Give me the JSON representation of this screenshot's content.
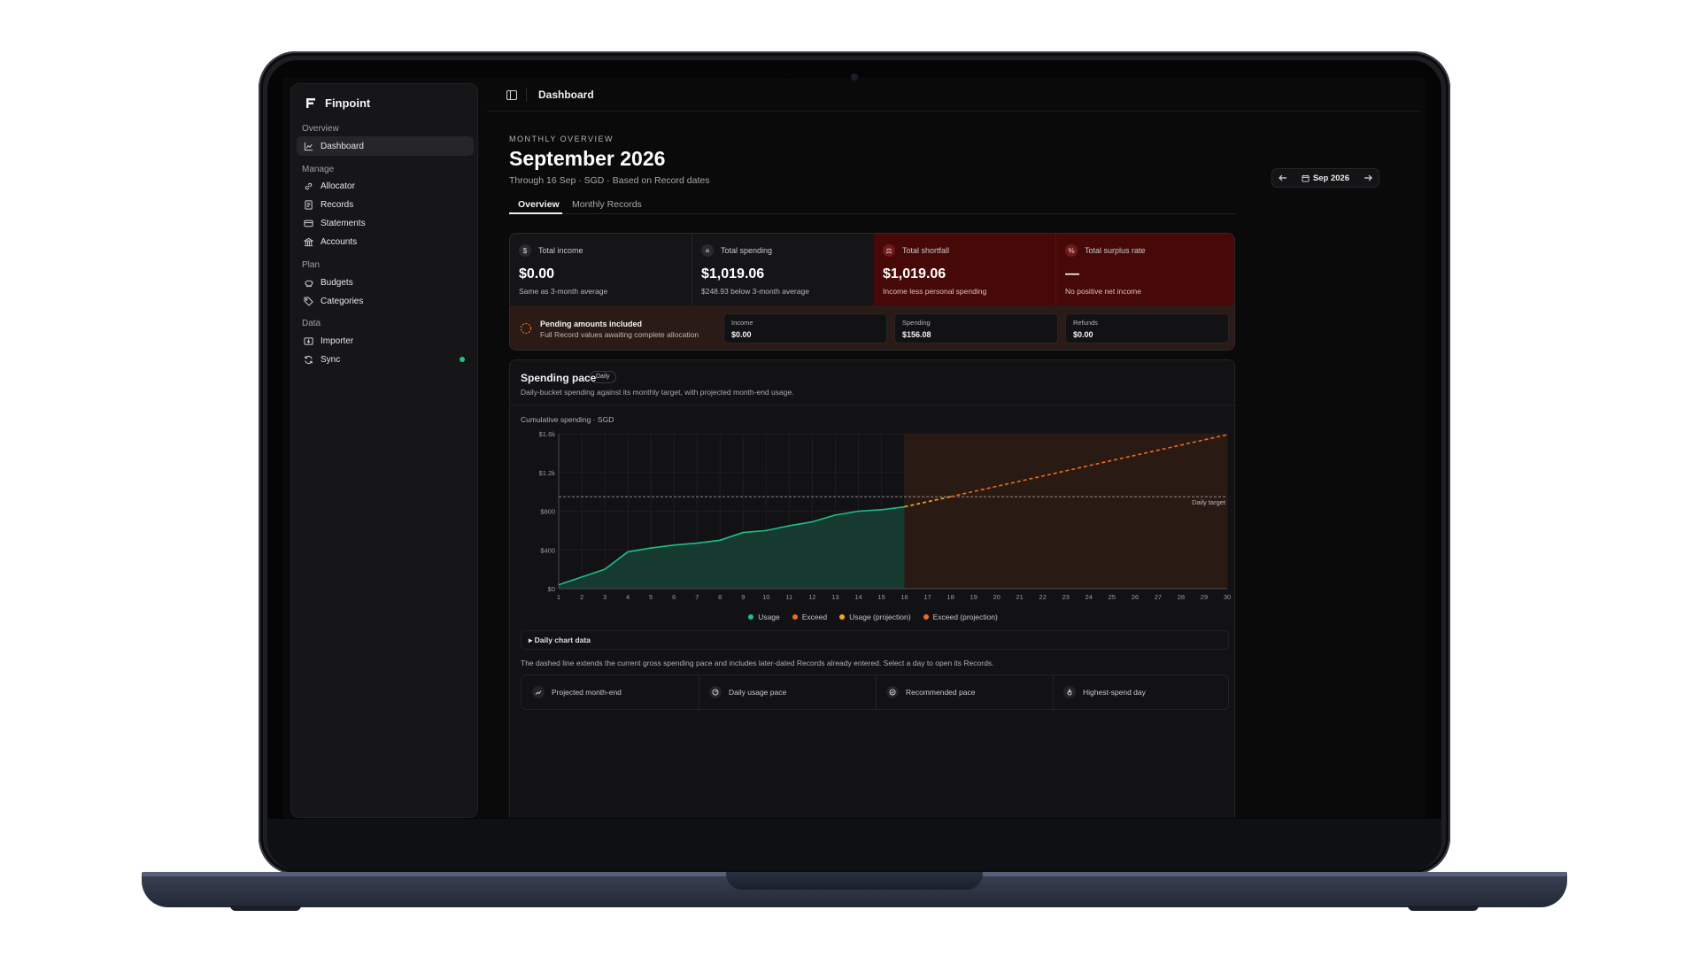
{
  "brand": {
    "name": "Finpoint"
  },
  "sidebar": {
    "sections": {
      "overview": "Overview",
      "manage": "Manage",
      "plan": "Plan",
      "data": "Data"
    },
    "items": {
      "dashboard": "Dashboard",
      "allocator": "Allocator",
      "records": "Records",
      "statements": "Statements",
      "accounts": "Accounts",
      "budgets": "Budgets",
      "categories": "Categories",
      "importer": "Importer",
      "sync": "Sync"
    }
  },
  "topbar": {
    "title": "Dashboard"
  },
  "header": {
    "eyebrow": "MONTHLY OVERVIEW",
    "title": "September 2026",
    "subtitle": "Through 16 Sep · SGD · Based on Record dates",
    "month_label": "Sep 2026"
  },
  "tabs": {
    "overview": "Overview",
    "monthly_records": "Monthly Records"
  },
  "kpis": {
    "income": {
      "label": "Total income",
      "value": "$0.00",
      "note": "Same as 3-month average"
    },
    "spending": {
      "label": "Total spending",
      "value": "$1,019.06",
      "note": "$248.93 below 3-month average"
    },
    "shortfall": {
      "label": "Total shortfall",
      "value": "$1,019.06",
      "note": "Income less personal spending"
    },
    "surplus": {
      "label": "Total surplus rate",
      "value": "—",
      "note": "No positive net income"
    }
  },
  "pending": {
    "title": "Pending amounts included",
    "subtitle": "Full Record values awaiting complete allocation",
    "income_label": "Income",
    "income_value": "$0.00",
    "spending_label": "Spending",
    "spending_value": "$156.08",
    "refunds_label": "Refunds",
    "refunds_value": "$0.00"
  },
  "pace": {
    "title": "Spending pace",
    "badge": "Daily",
    "subtitle": "Daily-bucket spending against its monthly target, with projected month-end usage.",
    "chart_label": "Cumulative spending · SGD",
    "details_label": "▸ Daily chart data",
    "footnote": "The dashed line extends the current gross spending pace and includes later-dated Records already entered. Select a day to open its Records.",
    "stats": {
      "projected": "Projected month-end",
      "daily_pace": "Daily usage pace",
      "recommended": "Recommended pace",
      "highest": "Highest-spend day"
    }
  },
  "colors": {
    "usage": "#1dbf84",
    "exceed": "#f26a21",
    "usage_projection": "#f5a623",
    "exceed_projection": "#f26a21"
  },
  "chart_data": {
    "type": "line",
    "ylabel": "Cumulative spending · SGD",
    "x": [
      1,
      2,
      3,
      4,
      5,
      6,
      7,
      8,
      9,
      10,
      11,
      12,
      13,
      14,
      15,
      16,
      17,
      18,
      19,
      20,
      21,
      22,
      23,
      24,
      25,
      26,
      27,
      28,
      29,
      30
    ],
    "xlim": [
      1,
      30
    ],
    "ylim": [
      0,
      1600
    ],
    "y_ticks": [
      0,
      400,
      800,
      1200,
      1600
    ],
    "y_tick_labels": [
      "$0",
      "$400",
      "$800",
      "$1.2k",
      "$1.6k"
    ],
    "target": {
      "label": "Daily target",
      "value": 950
    },
    "series": [
      {
        "name": "Usage",
        "x": [
          1,
          2,
          3,
          4,
          5,
          6,
          7,
          8,
          9,
          10,
          11,
          12,
          13,
          14,
          15,
          16
        ],
        "values": [
          40,
          120,
          200,
          380,
          420,
          450,
          470,
          500,
          580,
          600,
          650,
          690,
          760,
          800,
          815,
          845
        ]
      },
      {
        "name": "Usage (projection)",
        "x": [
          16,
          18
        ],
        "values": [
          845,
          950
        ]
      },
      {
        "name": "Exceed (projection)",
        "x": [
          18,
          30
        ],
        "values": [
          950,
          1590
        ]
      }
    ],
    "legend": [
      "Usage",
      "Exceed",
      "Usage (projection)",
      "Exceed (projection)"
    ],
    "grid": true
  }
}
